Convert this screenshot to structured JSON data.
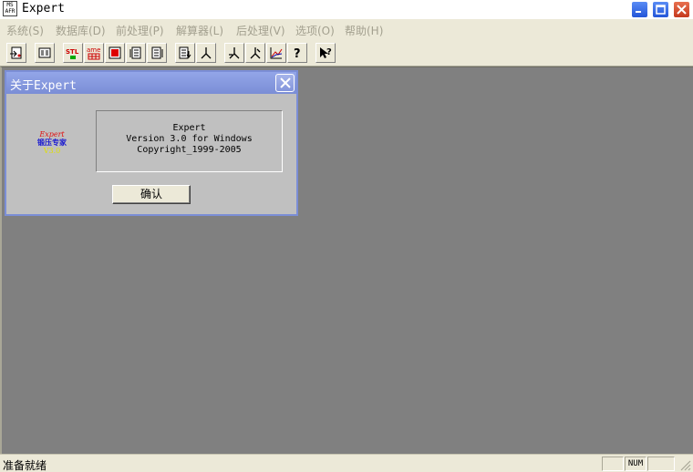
{
  "window": {
    "title": "Expert",
    "icon_text": [
      "MS",
      "AFR"
    ]
  },
  "menu": [
    {
      "label": "系统(S)"
    },
    {
      "label": "数据库(D)"
    },
    {
      "label": "前处理(P)"
    },
    {
      "label": "解算器(L)"
    },
    {
      "label": "后处理(V)"
    },
    {
      "label": "选项(O)"
    },
    {
      "label": "帮助(H)"
    }
  ],
  "toolbar": {
    "stl_label": "STL",
    "ame_label": "ame"
  },
  "dialog": {
    "title": "关于Expert",
    "logo": [
      "Expert",
      "锻压专家",
      "V3.0"
    ],
    "info_lines": [
      "Expert",
      "Version 3.0 for Windows",
      "Copyright_1999-2005"
    ],
    "ok_label": "确认"
  },
  "status": {
    "text": "准备就绪",
    "num_label": "NUM"
  },
  "colors": {
    "mdi_background": "#808080",
    "dialog_title": "#7b8ed6",
    "menu_disabled": "#a3a08f"
  }
}
